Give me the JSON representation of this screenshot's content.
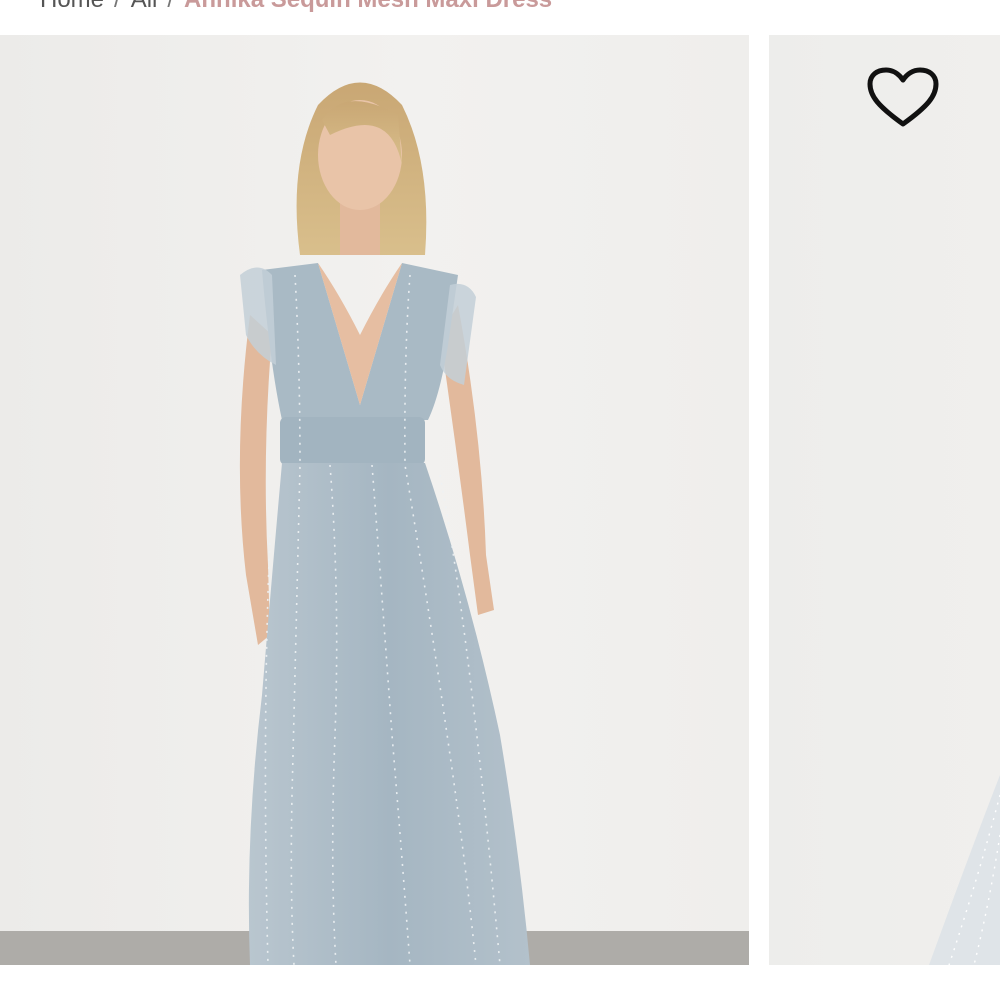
{
  "breadcrumb": {
    "home": "Home",
    "category": "All",
    "separator": "/",
    "current": "Annika Sequin Mesh Maxi Dress"
  },
  "gallery": {
    "main_image_label": "Annika Sequin Mesh Maxi Dress",
    "wishlist_icon": "heart-icon"
  },
  "colors": {
    "breadcrumb_current": "#c99a9a",
    "dress": "#a7b8c4",
    "backdrop": "#efeeec",
    "floor": "#aeaca8"
  }
}
